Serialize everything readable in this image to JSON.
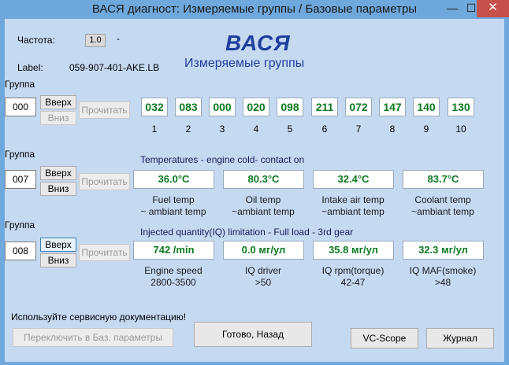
{
  "window": {
    "title": "ВАСЯ диагност: Измеряемые группы / Базовые параметры",
    "min": "—",
    "max": "☐",
    "close": "✕"
  },
  "header": {
    "freq_label": "Частота:",
    "freq_value": "1.0",
    "freq_dash": "-",
    "label_label": "Label:",
    "label_value": "059-907-401-AKE.LB",
    "app_name": "ВАСЯ",
    "subtitle": "Измеряемые группы"
  },
  "group1": {
    "title": "Группа",
    "number": "000",
    "up": "Вверх",
    "down": "Вниз",
    "read": "Прочитать",
    "values": [
      "032",
      "083",
      "000",
      "020",
      "098",
      "211",
      "072",
      "147",
      "140",
      "130"
    ],
    "indices": [
      "1",
      "2",
      "3",
      "4",
      "5",
      "6",
      "7",
      "8",
      "9",
      "10"
    ]
  },
  "group2": {
    "title": "Группа",
    "number": "007",
    "up": "Вверх",
    "down": "Вниз",
    "read": "Прочитать",
    "header": "Temperatures - engine cold- contact on",
    "cells": [
      {
        "value": "36.0°C",
        "line1": "Fuel temp",
        "line2": "~ ambiant temp"
      },
      {
        "value": "80.3°C",
        "line1": "Oil temp",
        "line2": "~ambiant temp"
      },
      {
        "value": "32.4°C",
        "line1": "Intake air temp",
        "line2": "~ambiant temp"
      },
      {
        "value": "83.7°C",
        "line1": "Coolant temp",
        "line2": "~ambiant temp"
      }
    ]
  },
  "group3": {
    "title": "Группа",
    "number": "008",
    "up": "Вверх",
    "down": "Вниз",
    "read": "Прочитать",
    "header": "Injected quantity(IQ) limitation - Full load - 3rd gear",
    "cells": [
      {
        "value": "742 /min",
        "line1": "Engine speed",
        "line2": "2800-3500"
      },
      {
        "value": "0.0 мг/ул",
        "line1": "IQ driver",
        "line2": ">50"
      },
      {
        "value": "35.8 мг/ул",
        "line1": "IQ rpm(torque)",
        "line2": "42-47"
      },
      {
        "value": "32.3 мг/ул",
        "line1": "IQ MAF(smoke)",
        "line2": ">48"
      }
    ]
  },
  "footer": {
    "note": "Используйте сервисную документацию!",
    "switch": "Переключить в Баз. параметры",
    "done": "Готово, Назад",
    "scope": "VC-Scope",
    "journal": "Журнал"
  },
  "colors": {
    "value_text": "#0b7a20",
    "title_blue": "#1f3f9c",
    "frame": "#6fa8dc",
    "panel": "#c5d9f1"
  }
}
